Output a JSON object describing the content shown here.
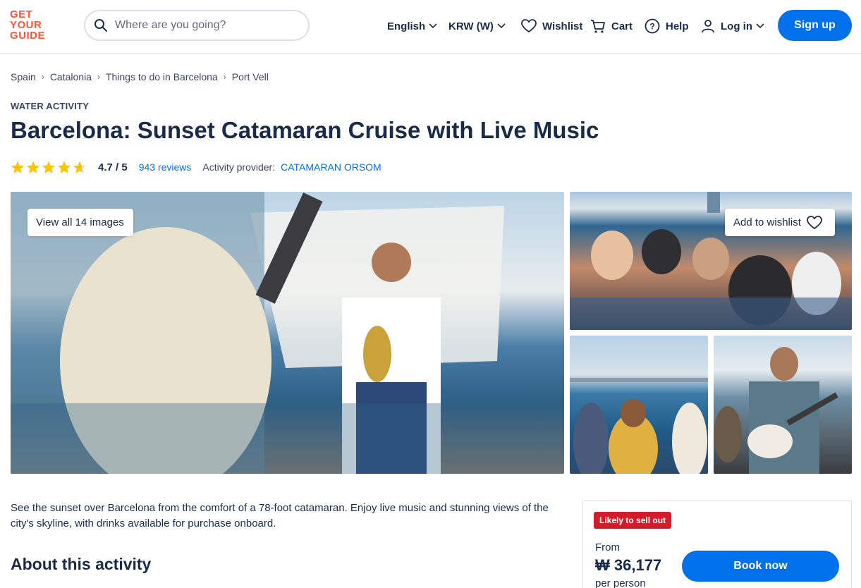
{
  "brand": {
    "logo_lines": [
      "GET",
      "YOUR",
      "GUIDE"
    ],
    "accent_color": "#ff5533",
    "primary_color": "#0071eb"
  },
  "header": {
    "search_placeholder": "Where are you going?",
    "language": "English",
    "currency": "KRW (W)",
    "wishlist": "Wishlist",
    "cart": "Cart",
    "help": "Help",
    "login": "Log in",
    "signup": "Sign up"
  },
  "breadcrumb": [
    "Spain",
    "Catalonia",
    "Things to do in Barcelona",
    "Port Vell"
  ],
  "activity": {
    "category": "WATER ACTIVITY",
    "title": "Barcelona: Sunset Catamaran Cruise with Live Music",
    "rating": 4.7,
    "rating_text": "4.7 / 5",
    "reviews": "943 reviews",
    "provider_label": "Activity provider:",
    "provider": "CATAMARAN ORSOM"
  },
  "gallery": {
    "view_all": "View all 14 images",
    "add_to_wishlist": "Add to wishlist"
  },
  "description": "See the sunset over Barcelona from the comfort of a 78-foot catamaran. Enjoy live music and stunning views of the city's skyline, with drinks available for purchase onboard.",
  "about_heading": "About this activity",
  "booking": {
    "badge": "Likely to sell out",
    "from": "From",
    "price": "₩ 36,177",
    "per": "per person",
    "book_now": "Book now"
  }
}
